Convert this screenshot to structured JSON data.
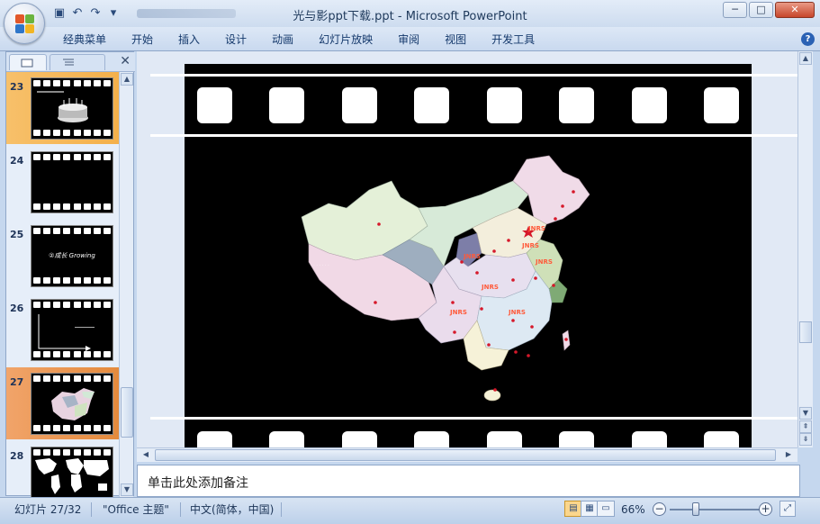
{
  "window": {
    "title": "光与影ppt下载.ppt - Microsoft PowerPoint",
    "controls": [
      "─",
      "□",
      "✕"
    ]
  },
  "ribbon": {
    "tabs": [
      "经典菜单",
      "开始",
      "插入",
      "设计",
      "动画",
      "幻灯片放映",
      "审阅",
      "视图",
      "开发工具"
    ],
    "help": "?"
  },
  "slides_panel": {
    "close": "✕",
    "thumbnails": [
      {
        "number": "23",
        "caption": ""
      },
      {
        "number": "24",
        "caption": ""
      },
      {
        "number": "25",
        "caption": "②成长 Growing"
      },
      {
        "number": "26",
        "caption": ""
      },
      {
        "number": "27",
        "caption": ""
      },
      {
        "number": "28",
        "caption": ""
      }
    ]
  },
  "notes": {
    "placeholder": "单击此处添加备注"
  },
  "status": {
    "slide_counter": "幻灯片 27/32",
    "theme": "\"Office 主题\"",
    "language": "中文(简体，中国)",
    "zoom": "66%"
  },
  "colors": {
    "accent": "#f4b04a",
    "current": "#e48a3c",
    "slide_bg": "#000000"
  }
}
